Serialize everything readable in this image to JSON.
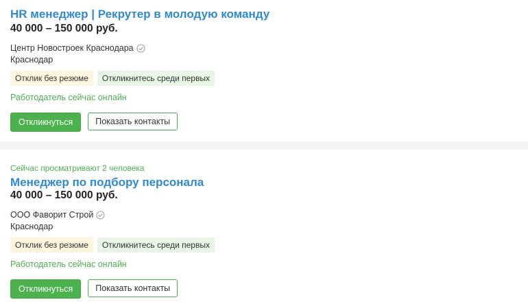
{
  "vacancies": [
    {
      "viewers": "",
      "title": "HR менеджер | Рекрутер в молодую команду",
      "salary": "40 000 – 150 000 руб.",
      "company": "Центр Новостроек Краснодара",
      "city": "Краснодар",
      "tags": [
        "Отклик без резюме",
        "Откликнитесь среди первых"
      ],
      "online": "Работодатель сейчас онлайн",
      "respond_label": "Откликнуться",
      "contacts_label": "Показать контакты"
    },
    {
      "viewers": "Сейчас просматривают 2 человека",
      "title": "Менеджер по подбору персонала",
      "salary": "40 000 – 150 000 руб.",
      "company": "ООО Фаворит Строй",
      "city": "Краснодар",
      "tags": [
        "Отклик без резюме",
        "Откликнитесь среди первых"
      ],
      "online": "Работодатель сейчас онлайн",
      "respond_label": "Откликнуться",
      "contacts_label": "Показать контакты"
    }
  ],
  "icons": {
    "verified": "check-circle-icon"
  },
  "colors": {
    "title": "#2d8ad7",
    "accent_green": "#4bb24e",
    "tag_yellow": "#fdf6df",
    "tag_green": "#e8f6e6"
  }
}
